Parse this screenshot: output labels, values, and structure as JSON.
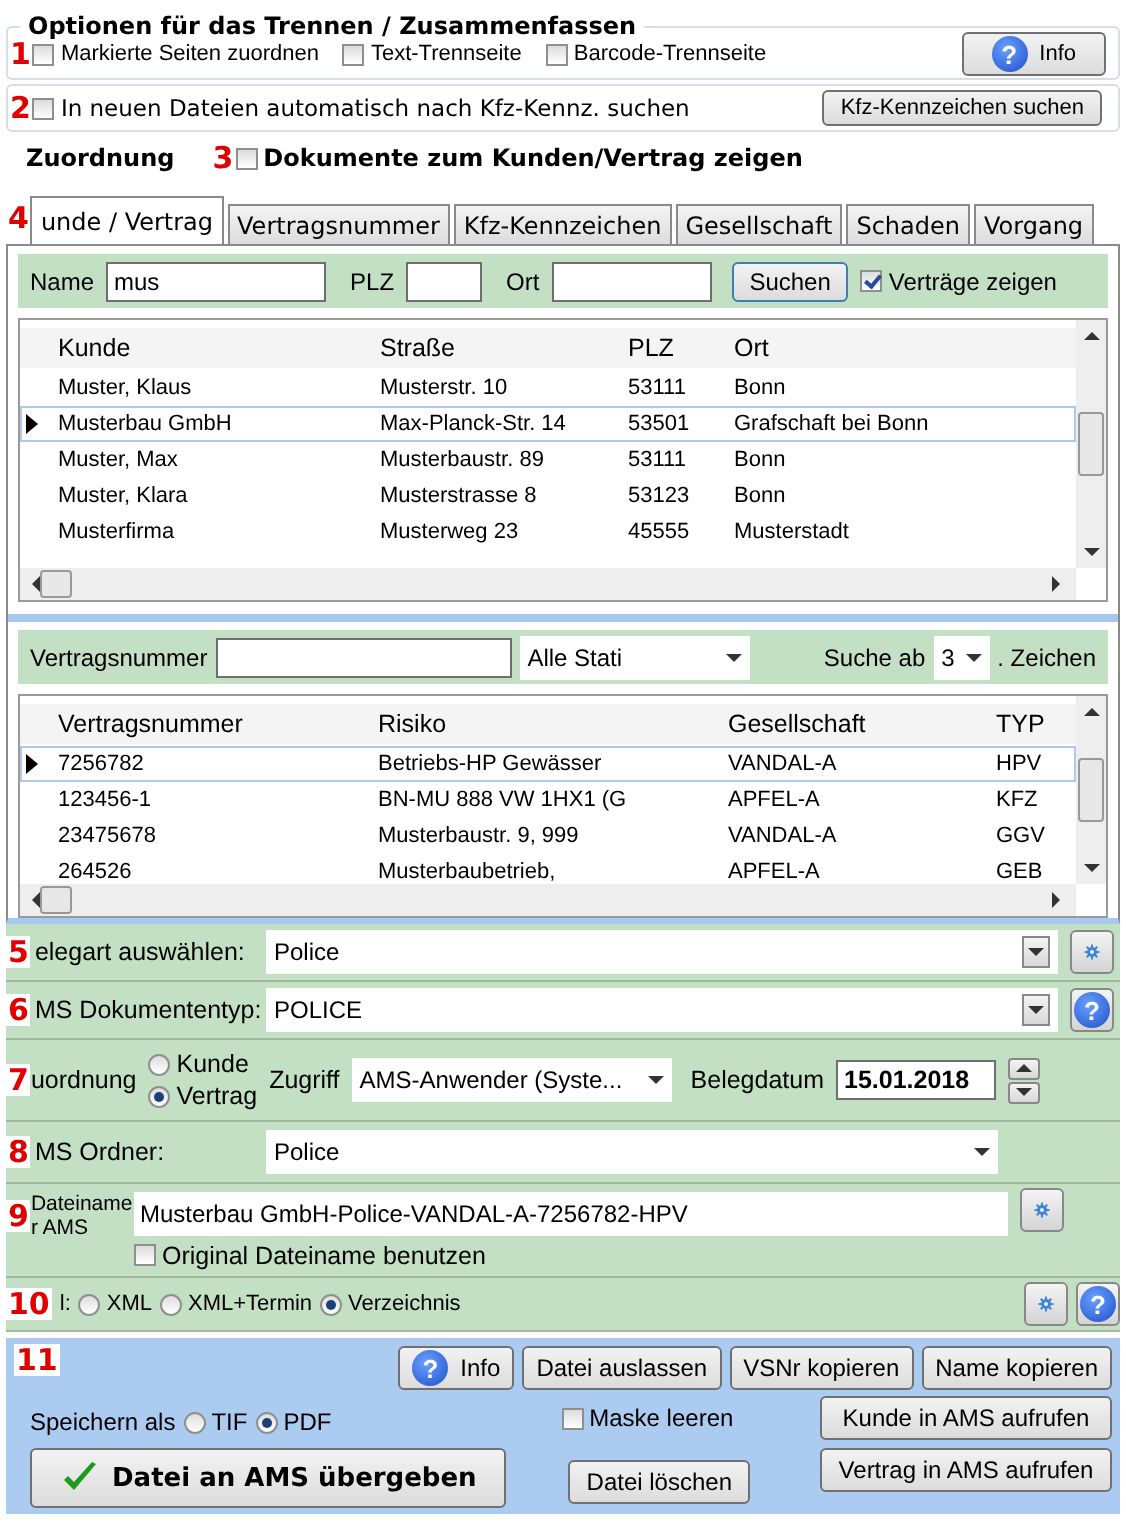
{
  "options": {
    "marker": "1",
    "title": "Optionen für das Trennen / Zusammenfassen",
    "checkboxes": [
      {
        "label": "Markierte Seiten zuordnen",
        "checked": false
      },
      {
        "label": "Text-Trennseite",
        "checked": false
      },
      {
        "label": "Barcode-Trennseite",
        "checked": false
      }
    ],
    "info_icon": "?",
    "info_button": "Info"
  },
  "auto_search": {
    "marker": "2",
    "checkbox": {
      "label": "In neuen Dateien automatisch nach Kfz-Kennz. suchen",
      "checked": false
    },
    "button": "Kfz-Kennzeichen suchen"
  },
  "assignment": {
    "title": "Zuordnung",
    "marker": "3",
    "checkbox": {
      "label": "Dokumente zum Kunden/Vertrag zeigen",
      "checked": false
    }
  },
  "tabs": {
    "marker": "4",
    "items": [
      {
        "label": "unde / Vertrag",
        "selected": true
      },
      {
        "label": "Vertragsnummer",
        "selected": false
      },
      {
        "label": "Kfz-Kennzeichen",
        "selected": false
      },
      {
        "label": "Gesellschaft",
        "selected": false
      },
      {
        "label": "Schaden",
        "selected": false
      },
      {
        "label": "Vorgang",
        "selected": false
      }
    ]
  },
  "customer_search": {
    "fields": [
      {
        "label": "Name",
        "value": "mus"
      },
      {
        "label": "PLZ"
      },
      {
        "label": "Ort"
      }
    ],
    "button": "Suchen",
    "show_contracts": {
      "label": "Verträge zeigen",
      "checked": true
    }
  },
  "customer_table": {
    "columns": [
      "Kunde",
      "Straße",
      "PLZ",
      "Ort"
    ],
    "rows": [
      {
        "cells": [
          "Muster, Klaus",
          "Musterstr. 10",
          "53111",
          "Bonn"
        ],
        "selected": false
      },
      {
        "cells": [
          "Musterbau GmbH",
          "Max-Planck-Str. 14",
          "53501",
          "Grafschaft bei Bonn"
        ],
        "selected": true
      },
      {
        "cells": [
          "Muster, Max",
          "Musterbaustr. 89",
          "53111",
          "Bonn"
        ],
        "selected": false
      },
      {
        "cells": [
          "Muster, Klara",
          "Musterstrasse 8",
          "53123",
          "Bonn"
        ],
        "selected": false
      },
      {
        "cells": [
          "Musterfirma",
          "Musterweg 23",
          "45555",
          "Musterstadt"
        ],
        "selected": false
      }
    ]
  },
  "contract_search": {
    "label": "Vertragsnummer",
    "status": "Alle Stati",
    "search_from_label": "Suche ab",
    "search_from_value": "3",
    "suffix": ". Zeichen"
  },
  "contract_table": {
    "columns": [
      "Vertragsnummer",
      "Risiko",
      "Gesellschaft",
      "TYP"
    ],
    "rows": [
      {
        "cells": [
          "7256782",
          "Betriebs-HP Gewässer",
          "VANDAL-A",
          "HPV"
        ],
        "selected": true
      },
      {
        "cells": [
          "123456-1",
          "BN-MU 888 VW 1HX1 (G",
          "APFEL-A",
          "KFZ"
        ],
        "selected": false
      },
      {
        "cells": [
          "23475678",
          "Musterbaustr. 9, 999",
          "VANDAL-A",
          "GGV"
        ],
        "selected": false
      },
      {
        "cells": [
          "264526",
          "Musterbaubetrieb,",
          "APFEL-A",
          "GEB"
        ],
        "selected": false
      }
    ]
  },
  "document_type": {
    "marker": "5",
    "label": "elegart auswählen:",
    "value": "Police"
  },
  "ams_document_type": {
    "marker": "6",
    "label": "MS Dokumententyp:",
    "value": "POLICE",
    "help_icon": "?"
  },
  "allocation": {
    "marker": "7",
    "label": "uordnung",
    "radios": [
      {
        "label": "Kunde",
        "selected": false
      },
      {
        "label": "Vertrag",
        "selected": true
      }
    ],
    "access_label": "Zugriff",
    "access_value": "AMS-Anwender (Syste...",
    "date_label": "Belegdatum",
    "date": "15.01.2018"
  },
  "ams_folder": {
    "marker": "8",
    "label": "MS Ordner:",
    "value": "Police"
  },
  "file_name": {
    "marker": "9",
    "label_lines": [
      "Dateiname",
      "r AMS"
    ],
    "value": "Musterbau GmbH-Police-VANDAL-A-7256782-HPV",
    "checkbox": {
      "label": "Original Dateiname benutzen",
      "checked": false
    }
  },
  "target": {
    "marker": "10",
    "label": "l:",
    "radios": [
      {
        "label": "XML",
        "selected": false
      },
      {
        "label": "XML+Termin",
        "selected": false
      },
      {
        "label": "Verzeichnis",
        "selected": true
      }
    ],
    "help_icon": "?"
  },
  "actions": {
    "marker": "11",
    "info_icon": "?",
    "buttons": [
      "Info",
      "Datei auslassen",
      "VSNr kopieren",
      "Name kopieren"
    ],
    "save_as_label": "Speichern als",
    "formats": [
      {
        "label": "TIF",
        "selected": false
      },
      {
        "label": "PDF",
        "selected": true
      }
    ],
    "clear": {
      "label": "Maske leeren",
      "checked": false
    },
    "submit": "Datei an AMS übergeben",
    "delete": "Datei löschen",
    "open_customer": "Kunde in AMS aufrufen",
    "open_contract": "Vertrag in AMS aufrufen"
  }
}
